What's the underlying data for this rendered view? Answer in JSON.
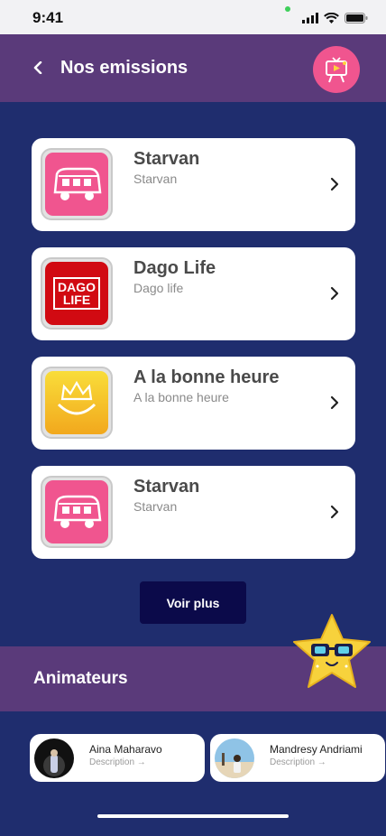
{
  "status": {
    "time": "9:41"
  },
  "header": {
    "title": "Nos emissions",
    "back_icon": "chevron-left-icon",
    "logo_icon": "tv-logo-icon",
    "color": "#5a3a7a"
  },
  "shows": [
    {
      "title": "Starvan",
      "subtitle": "Starvan",
      "thumb": "van-logo",
      "thumb_color": "#f0558f"
    },
    {
      "title": "Dago Life",
      "subtitle": "Dago life",
      "thumb": "dago-life-logo",
      "thumb_color": "#d10a12",
      "logo_text_1": "DAGO",
      "logo_text_2": "LIFE"
    },
    {
      "title": "A la bonne heure",
      "subtitle": "A la bonne heure",
      "thumb": "crown-smile-logo",
      "thumb_color": "#f7c61f"
    },
    {
      "title": "Starvan",
      "subtitle": "Starvan",
      "thumb": "van-logo",
      "thumb_color": "#f0558f"
    }
  ],
  "more_button": {
    "label": "Voir plus",
    "color": "#0b0a4a"
  },
  "animateurs": {
    "title": "Animateurs",
    "hosts": [
      {
        "name": "Aina Maharavo",
        "description": "Description →"
      },
      {
        "name": "Mandresy Andriami",
        "description": "Description →"
      }
    ]
  },
  "colors": {
    "background": "#1f2d6e",
    "accent_pink": "#f0558f",
    "mascot_yellow": "#f7d23c"
  }
}
